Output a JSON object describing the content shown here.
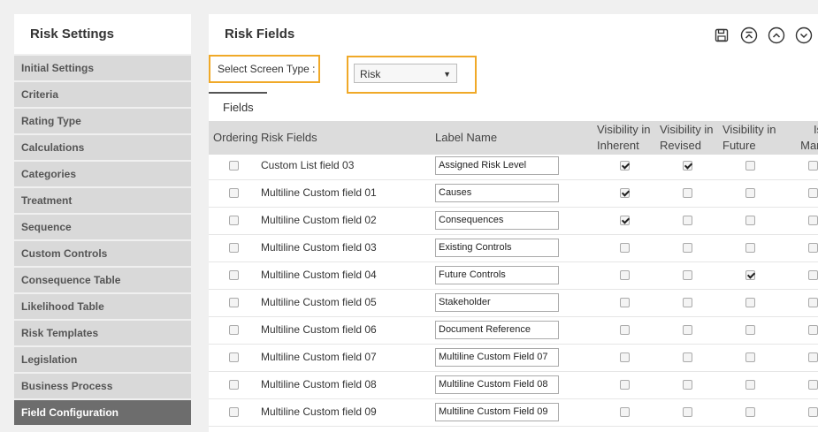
{
  "sidebar": {
    "title": "Risk Settings",
    "items": [
      {
        "label": "Initial Settings"
      },
      {
        "label": "Criteria"
      },
      {
        "label": "Rating Type"
      },
      {
        "label": "Calculations"
      },
      {
        "label": "Categories"
      },
      {
        "label": "Treatment"
      },
      {
        "label": "Sequence"
      },
      {
        "label": "Custom Controls"
      },
      {
        "label": "Consequence Table"
      },
      {
        "label": "Likelihood Table"
      },
      {
        "label": "Risk Templates"
      },
      {
        "label": "Legislation"
      },
      {
        "label": "Business Process"
      },
      {
        "label": "Field Configuration"
      }
    ]
  },
  "main": {
    "title": "Risk Fields",
    "screen_type_label": "Select Screen Type :",
    "screen_type_value": "Risk",
    "tab_label": "Fields",
    "toolbar_icons": [
      "save-icon",
      "collapse-all-icon",
      "collapse-icon",
      "expand-icon"
    ]
  },
  "table": {
    "headers": {
      "ordering": "Ordering",
      "risk_fields": "Risk Fields",
      "label_name": "Label Name",
      "vis_inherent_1": "Visibility in",
      "vis_inherent_2": "Inherent",
      "vis_revised_1": "Visibility in",
      "vis_revised_2": "Revised",
      "vis_future_1": "Visibility in",
      "vis_future_2": "Future",
      "mandatory_1": "Is",
      "mandatory_2": "Manda"
    },
    "rows": [
      {
        "field": "Custom List field 03",
        "label": "Assigned Risk Level",
        "ordering": false,
        "inherent": true,
        "revised": true,
        "future": false,
        "mandatory": false
      },
      {
        "field": "Multiline Custom field 01",
        "label": "Causes",
        "ordering": false,
        "inherent": true,
        "revised": false,
        "future": false,
        "mandatory": false
      },
      {
        "field": "Multiline Custom field 02",
        "label": "Consequences",
        "ordering": false,
        "inherent": true,
        "revised": false,
        "future": false,
        "mandatory": false
      },
      {
        "field": "Multiline Custom field 03",
        "label": "Existing Controls",
        "ordering": false,
        "inherent": false,
        "revised": false,
        "future": false,
        "mandatory": false
      },
      {
        "field": "Multiline Custom field 04",
        "label": "Future Controls",
        "ordering": false,
        "inherent": false,
        "revised": false,
        "future": true,
        "mandatory": false
      },
      {
        "field": "Multiline Custom field 05",
        "label": "Stakeholder",
        "ordering": false,
        "inherent": false,
        "revised": false,
        "future": false,
        "mandatory": false
      },
      {
        "field": "Multiline Custom field 06",
        "label": "Document Reference",
        "ordering": false,
        "inherent": false,
        "revised": false,
        "future": false,
        "mandatory": false
      },
      {
        "field": "Multiline Custom field 07",
        "label": "Multiline Custom Field 07",
        "ordering": false,
        "inherent": false,
        "revised": false,
        "future": false,
        "mandatory": false
      },
      {
        "field": "Multiline Custom field 08",
        "label": "Multiline Custom Field 08",
        "ordering": false,
        "inherent": false,
        "revised": false,
        "future": false,
        "mandatory": false
      },
      {
        "field": "Multiline Custom field 09",
        "label": "Multiline Custom Field 09",
        "ordering": false,
        "inherent": false,
        "revised": false,
        "future": false,
        "mandatory": false
      }
    ]
  },
  "colors": {
    "highlight": "#f0a928",
    "sidebar_item_bg": "#d9d9d9",
    "sidebar_active_bg": "#6d6d6d",
    "header_bg": "#dcdcdc"
  }
}
